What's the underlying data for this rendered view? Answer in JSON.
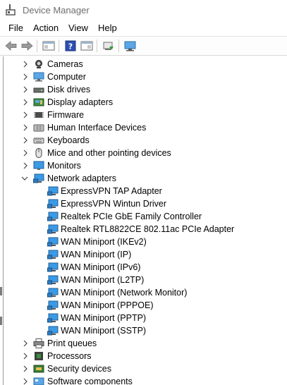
{
  "window": {
    "title": "Device Manager"
  },
  "menu": [
    "File",
    "Action",
    "View",
    "Help"
  ],
  "icons": {
    "accent": "#2f8fd8",
    "category_icons": [
      "camera-icon",
      "computer-icon",
      "disk-drive-icon",
      "display-adapter-icon",
      "firmware-icon",
      "hid-icon",
      "keyboard-icon",
      "mouse-icon",
      "monitor-icon",
      "network-adapter-icon"
    ],
    "child_icon": "network-card-icon"
  },
  "tree": {
    "categories_top": [
      {
        "label": "Cameras",
        "icon": "camera-icon"
      },
      {
        "label": "Computer",
        "icon": "computer-icon"
      },
      {
        "label": "Disk drives",
        "icon": "disk-drive-icon"
      },
      {
        "label": "Display adapters",
        "icon": "display-adapter-icon"
      },
      {
        "label": "Firmware",
        "icon": "firmware-icon"
      },
      {
        "label": "Human Interface Devices",
        "icon": "hid-icon"
      },
      {
        "label": "Keyboards",
        "icon": "keyboard-icon"
      },
      {
        "label": "Mice and other pointing devices",
        "icon": "mouse-icon"
      },
      {
        "label": "Monitors",
        "icon": "monitor-icon"
      }
    ],
    "expanded": {
      "label": "Network adapters",
      "icon": "network-adapter-icon",
      "children": [
        "ExpressVPN TAP Adapter",
        "ExpressVPN Wintun Driver",
        "Realtek PCIe GbE Family Controller",
        "Realtek RTL8822CE 802.11ac PCIe Adapter",
        "WAN Miniport (IKEv2)",
        "WAN Miniport (IP)",
        "WAN Miniport (IPv6)",
        "WAN Miniport (L2TP)",
        "WAN Miniport (Network Monitor)",
        "WAN Miniport (PPPOE)",
        "WAN Miniport (PPTP)",
        "WAN Miniport (SSTP)"
      ]
    },
    "categories_bottom": [
      {
        "label": "Print queues",
        "icon": "printer-icon"
      },
      {
        "label": "Processors",
        "icon": "processor-icon"
      },
      {
        "label": "Security devices",
        "icon": "security-device-icon"
      },
      {
        "label": "Software components",
        "icon": "software-component-icon"
      }
    ]
  }
}
